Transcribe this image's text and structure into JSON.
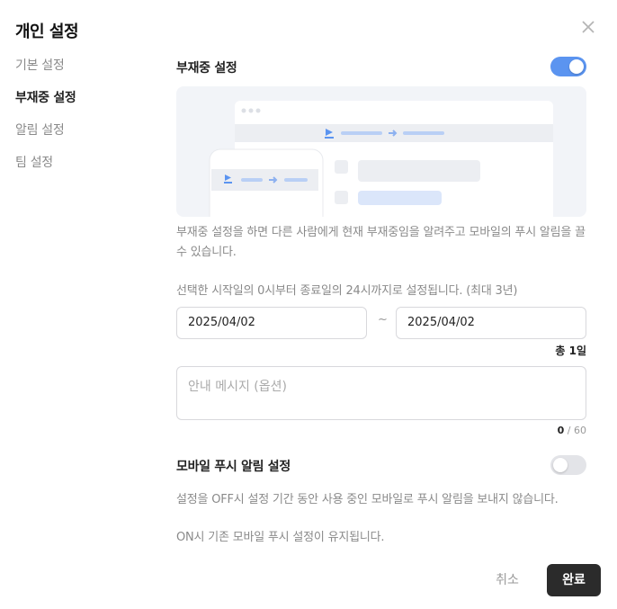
{
  "dialog": {
    "title": "개인 설정"
  },
  "nav": {
    "items": [
      {
        "label": "기본 설정"
      },
      {
        "label": "부재중 설정"
      },
      {
        "label": "알림 설정"
      },
      {
        "label": "팀 설정"
      }
    ],
    "active_index": 1
  },
  "away": {
    "heading": "부재중 설정",
    "toggle_on": true,
    "description": "부재중 설정을 하면 다른 사람에게 현재 부재중임을 알려주고 모바일의 푸시 알림을 끌 수 있습니다.",
    "period_note": "선택한 시작일의 0시부터 종료일의 24시까지로 설정됩니다. (최대 3년)",
    "start_date": "2025/04/02",
    "end_date": "2025/04/02",
    "date_separator": "~",
    "total_label": "총 1일",
    "message_placeholder": "안내 메시지 (옵션)",
    "message_count": "0",
    "message_max": "60"
  },
  "mobile_push": {
    "heading": "모바일 푸시 알림 설정",
    "toggle_on": false,
    "description_line1": "설정을 OFF시 설정 기간 동안 사용 중인 모바일로 푸시 알림을 보내지 않습니다.",
    "description_line2": "ON시 기존 모바일 푸시 설정이 유지됩니다."
  },
  "footer": {
    "cancel_label": "취소",
    "done_label": "완료"
  },
  "colors": {
    "accent": "#5b94f0",
    "primary_button": "#2b2b2b",
    "illustration_bg": "#f2f4f8"
  }
}
